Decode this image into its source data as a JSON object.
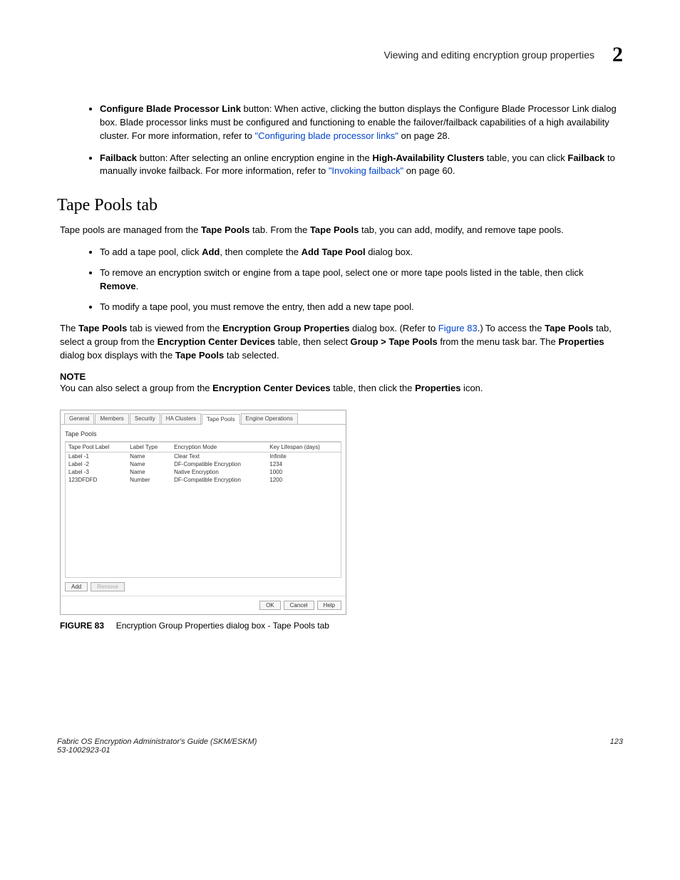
{
  "header": {
    "title": "Viewing and editing encryption group properties",
    "chapter": "2"
  },
  "bullets_top": [
    {
      "pre": "",
      "bold1": "Configure Blade Processor Link",
      "mid1": " button: When active, clicking the button displays the Configure Blade Processor Link dialog box. Blade processor links must be configured and functioning to enable the failover/failback capabilities of a high availability cluster. For more information, refer to ",
      "link": "\"Configuring blade processor links\"",
      "post1": " on page 28."
    },
    {
      "pre": "",
      "bold1": "Failback",
      "mid1": " button: After selecting an online encryption engine in the ",
      "bold2": "High-Availability Clusters",
      "mid2": " table, you can click ",
      "bold3": "Failback",
      "mid3": " to manually invoke failback. For more information, refer to ",
      "link": "\"Invoking failback\"",
      "post1": " on page 60."
    }
  ],
  "section": {
    "title": "Tape Pools tab",
    "intro_pre": "Tape pools are managed from the ",
    "intro_b1": "Tape Pools",
    "intro_mid": " tab. From the ",
    "intro_b2": "Tape Pools",
    "intro_post": " tab, you can add, modify, and remove tape pools."
  },
  "sub_bullets": [
    {
      "pre": "To add a tape pool, click ",
      "b1": "Add",
      "mid1": ", then complete the ",
      "b2": "Add Tape Pool",
      "post": " dialog box."
    },
    {
      "pre": "To remove an encryption switch or engine from a tape pool, select one or more tape pools listed in the table, then click ",
      "b1": "Remove",
      "post": "."
    },
    {
      "pre": "To modify a tape pool, you must remove the entry, then add a new tape pool."
    }
  ],
  "para3": {
    "p1": "The ",
    "b1": "Tape Pools",
    "p2": " tab is viewed from the ",
    "b2": "Encryption Group Properties",
    "p3": " dialog box. (Refer to ",
    "link": "Figure 83",
    "p4": ".) To access the ",
    "b3": "Tape Pools",
    "p5": " tab, select a group from the ",
    "b4": "Encryption Center Devices",
    "p6": " table, then select ",
    "b5": "Group > Tape Pools",
    "p7": " from the menu task bar. The ",
    "b6": "Properties",
    "p8": " dialog box displays with the ",
    "b7": "Tape Pools",
    "p9": " tab selected."
  },
  "note": {
    "label": "NOTE",
    "p1": "You can also select a group from the ",
    "b1": "Encryption Center Devices",
    "p2": " table, then click the ",
    "b2": "Properties",
    "p3": " icon."
  },
  "dialog": {
    "tabs": [
      "General",
      "Members",
      "Security",
      "HA Clusters",
      "Tape Pools",
      "Engine Operations"
    ],
    "active_tab": "Tape Pools",
    "sub": "Tape Pools",
    "columns": [
      "Tape Pool Label",
      "Label Type",
      "Encryption Mode",
      "Key Lifespan (days)"
    ],
    "rows": [
      [
        "Label -1",
        "Name",
        "Clear Text",
        "Infinite"
      ],
      [
        "Label -2",
        "Name",
        "DF-Compatible Encryption",
        "1234"
      ],
      [
        "Label -3",
        "Name",
        "Native Encryption",
        "1000"
      ],
      [
        "123DFDFD",
        "Number",
        "DF-Compatible Encryption",
        "1200"
      ]
    ],
    "buttons": {
      "add": "Add",
      "remove": "Remove",
      "ok": "OK",
      "cancel": "Cancel",
      "help": "Help"
    }
  },
  "caption": {
    "label": "FIGURE 83",
    "text": "Encryption Group Properties dialog box - Tape Pools tab"
  },
  "footer": {
    "left1": "Fabric OS Encryption Administrator's Guide (SKM/ESKM)",
    "left2": "53-1002923-01",
    "right": "123"
  }
}
